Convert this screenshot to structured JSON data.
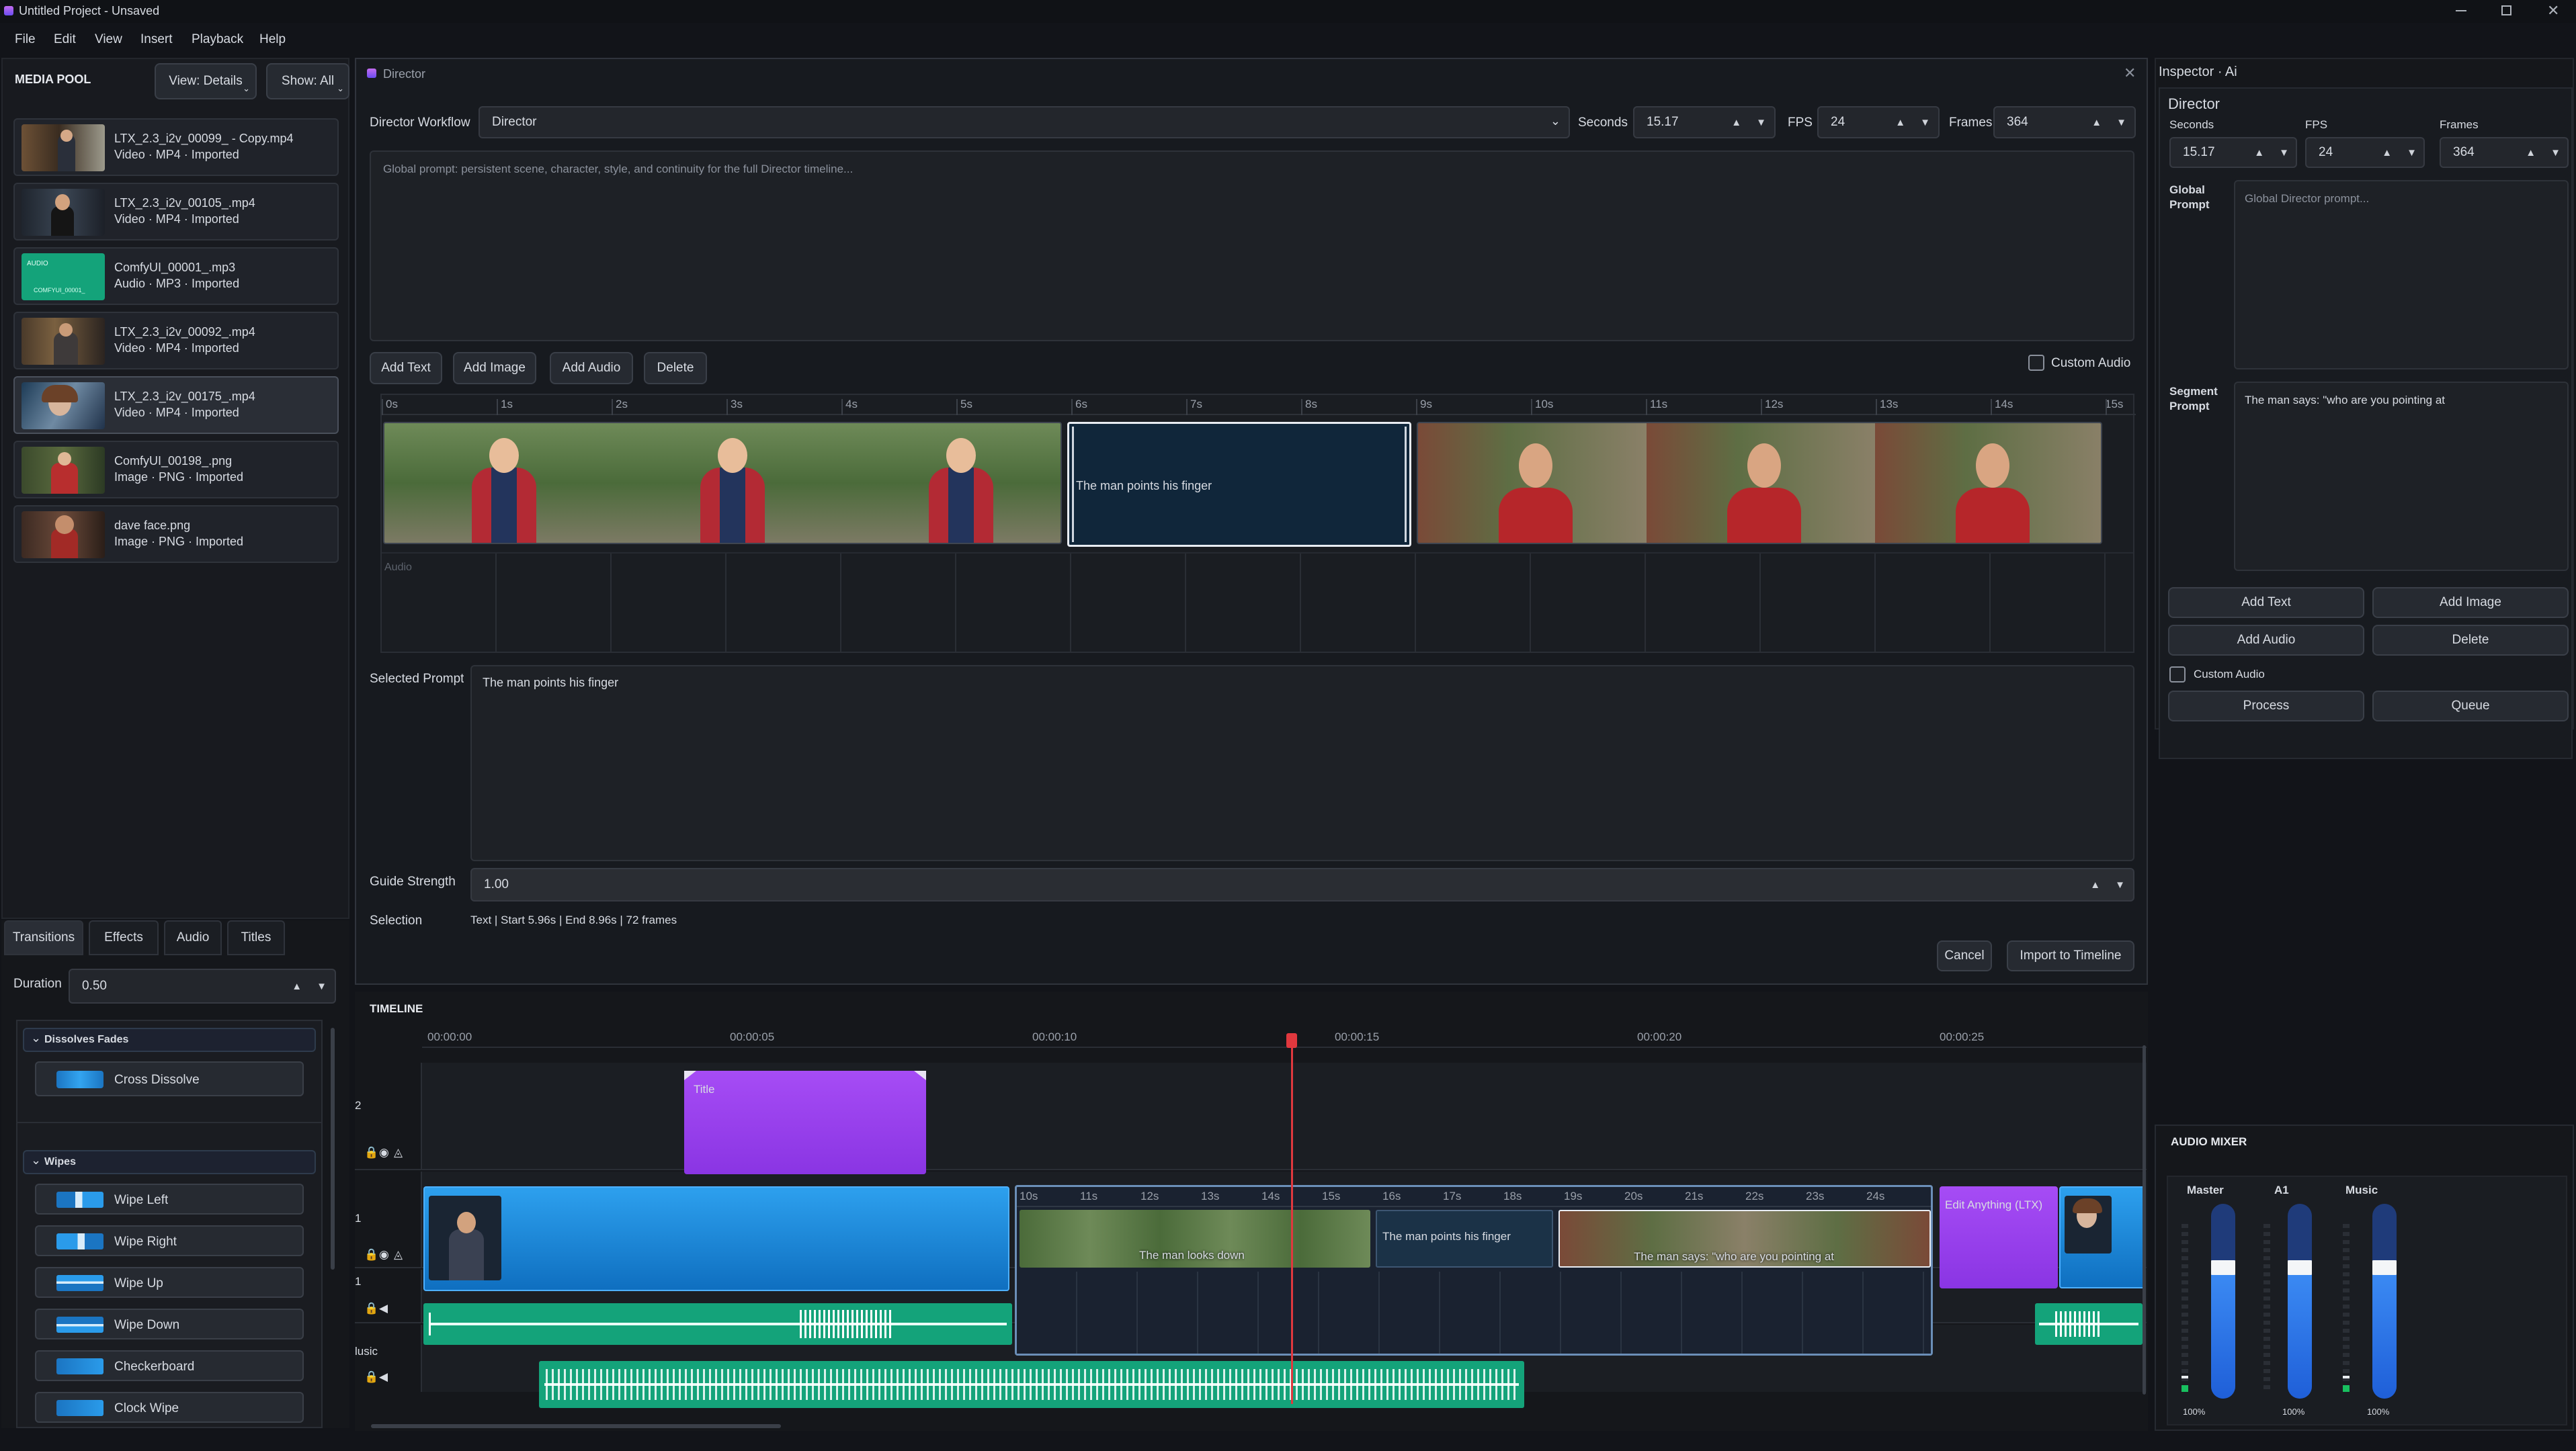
{
  "window": {
    "title": "Untitled Project - Unsaved"
  },
  "menu": [
    "File",
    "Edit",
    "View",
    "Insert",
    "Playback",
    "Help"
  ],
  "media_pool": {
    "title": "MEDIA POOL",
    "view_btn": "View: Details",
    "show_btn": "Show: All",
    "items": [
      {
        "name": "LTX_2.3_i2v_00099_ - Copy.mp4",
        "meta": "Video  ·  MP4  ·  Imported"
      },
      {
        "name": "LTX_2.3_i2v_00105_.mp4",
        "meta": "Video  ·  MP4  ·  Imported"
      },
      {
        "name": "ComfyUI_00001_.mp3",
        "meta": "Audio  ·  MP3  ·  Imported",
        "thumb_label": "AUDIO",
        "thumb_sub": "COMFYUI_00001_"
      },
      {
        "name": "LTX_2.3_i2v_00092_.mp4",
        "meta": "Video  ·  MP4  ·  Imported"
      },
      {
        "name": "LTX_2.3_i2v_00175_.mp4",
        "meta": "Video  ·  MP4  ·  Imported"
      },
      {
        "name": "ComfyUI_00198_.png",
        "meta": "Image  ·  PNG  ·  Imported"
      },
      {
        "name": "dave face.png",
        "meta": "Image  ·  PNG  ·  Imported"
      }
    ]
  },
  "effects_panel": {
    "tabs": [
      "Transitions",
      "Effects",
      "Audio",
      "Titles"
    ],
    "duration_label": "Duration",
    "duration_value": "0.50",
    "group1": "Dissolves  Fades",
    "group1_items": [
      "Cross Dissolve"
    ],
    "group2": "Wipes",
    "group2_items": [
      "Wipe Left",
      "Wipe Right",
      "Wipe Up",
      "Wipe Down",
      "Checkerboard",
      "Clock Wipe"
    ]
  },
  "director": {
    "title": "Director",
    "workflow_label": "Director Workflow",
    "workflow_value": "Director",
    "seconds_label": "Seconds",
    "seconds_value": "15.17",
    "fps_label": "FPS",
    "fps_value": "24",
    "frames_label": "Frames",
    "frames_value": "364",
    "global_placeholder": "Global prompt: persistent scene, character, style, and continuity for the full Director timeline...",
    "buttons": [
      "Add Text",
      "Add Image",
      "Add Audio",
      "Delete"
    ],
    "custom_audio": "Custom Audio",
    "ruler": [
      "0s",
      "1s",
      "2s",
      "3s",
      "4s",
      "5s",
      "6s",
      "7s",
      "8s",
      "9s",
      "10s",
      "11s",
      "12s",
      "13s",
      "14s",
      "15s"
    ],
    "text_segment": "The man points his finger",
    "audio_label": "Audio",
    "selected_prompt_label": "Selected Prompt",
    "selected_prompt": "The man points his finger",
    "guide_label": "Guide Strength",
    "guide_value": "1.00",
    "selection_label": "Selection",
    "selection_value": "Text | Start 5.96s | End 8.96s | 72 frames",
    "cancel": "Cancel",
    "import": "Import to Timeline"
  },
  "inspector": {
    "title": "Inspector · Ai",
    "section": "Director",
    "seconds_label": "Seconds",
    "seconds_value": "15.17",
    "fps_label": "FPS",
    "fps_value": "24",
    "frames_label": "Frames",
    "frames_value": "364",
    "global_label": "Global Prompt",
    "global_placeholder": "Global Director prompt...",
    "segment_label": "Segment Prompt",
    "segment_value": "The man says: \"who are you pointing at",
    "buttons": [
      "Add Text",
      "Add Image",
      "Add Audio",
      "Delete"
    ],
    "custom_audio": "Custom Audio",
    "process": "Process",
    "queue": "Queue"
  },
  "timeline": {
    "title": "TIMELINE",
    "ruler": [
      "00:00:00",
      "00:00:05",
      "00:00:10",
      "00:00:15",
      "00:00:20",
      "00:00:25"
    ],
    "track_labels": [
      "2",
      "1",
      "1",
      "lusic"
    ],
    "title_clip": "Title",
    "inner_ruler": [
      "10s",
      "11s",
      "12s",
      "13s",
      "14s",
      "15s",
      "16s",
      "17s",
      "18s",
      "19s",
      "20s",
      "21s",
      "22s",
      "23s",
      "24s"
    ],
    "seg1": "The man looks down",
    "seg2": "The man points his finger",
    "seg3": "The man says: \"who are you pointing at",
    "edit_clip": "Edit Anything (LTX)"
  },
  "mixer": {
    "title": "AUDIO MIXER",
    "channels": [
      {
        "name": "Master",
        "level": "100%",
        "fader": 0.78
      },
      {
        "name": "A1",
        "level": "100%",
        "fader": 0.78
      },
      {
        "name": "Music",
        "level": "100%",
        "fader": 0.78
      }
    ]
  },
  "colors": {
    "accent_blue": "#2a9bea",
    "purple": "#9a43ef",
    "green": "#14a37a",
    "playhead": "#e0383e"
  }
}
